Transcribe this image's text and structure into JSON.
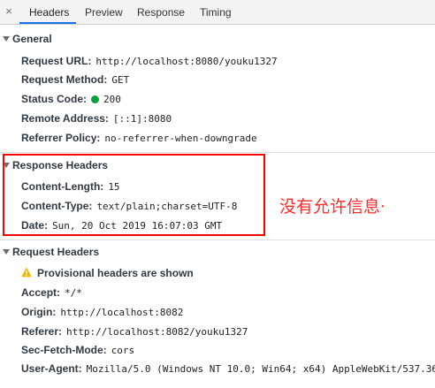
{
  "tabs": [
    {
      "label": "Headers"
    },
    {
      "label": "Preview"
    },
    {
      "label": "Response"
    },
    {
      "label": "Timing"
    }
  ],
  "close_glyph": "×",
  "general": {
    "title": "General",
    "rows": [
      {
        "key": "Request URL:",
        "value": "http://localhost:8080/youku1327"
      },
      {
        "key": "Request Method:",
        "value": "GET"
      },
      {
        "key": "Status Code:",
        "value": "200",
        "status_color": "#0a9e3d"
      },
      {
        "key": "Remote Address:",
        "value": "[::1]:8080"
      },
      {
        "key": "Referrer Policy:",
        "value": "no-referrer-when-downgrade"
      }
    ]
  },
  "response_headers": {
    "title": "Response Headers",
    "rows": [
      {
        "key": "Content-Length:",
        "value": "15"
      },
      {
        "key": "Content-Type:",
        "value": "text/plain;charset=UTF-8"
      },
      {
        "key": "Date:",
        "value": "Sun, 20 Oct 2019 16:07:03 GMT"
      }
    ]
  },
  "annotation": "没有允许信息·",
  "request_headers": {
    "title": "Request Headers",
    "provisional": "Provisional headers are shown",
    "warning_icon": "warning-icon",
    "rows": [
      {
        "key": "Accept:",
        "value": "*/*"
      },
      {
        "key": "Origin:",
        "value": "http://localhost:8082"
      },
      {
        "key": "Referer:",
        "value": "http://localhost:8082/youku1327"
      },
      {
        "key": "Sec-Fetch-Mode:",
        "value": "cors"
      },
      {
        "key": "User-Agent:",
        "value": "Mozilla/5.0 (Windows NT 10.0; Win64; x64) AppleWebKit/537.36"
      }
    ]
  },
  "colors": {
    "active_tab_underline": "#1a73e8",
    "highlight_box": "#ff0000",
    "annotation_text": "#ff2a2a",
    "warning": "#f4b400"
  }
}
